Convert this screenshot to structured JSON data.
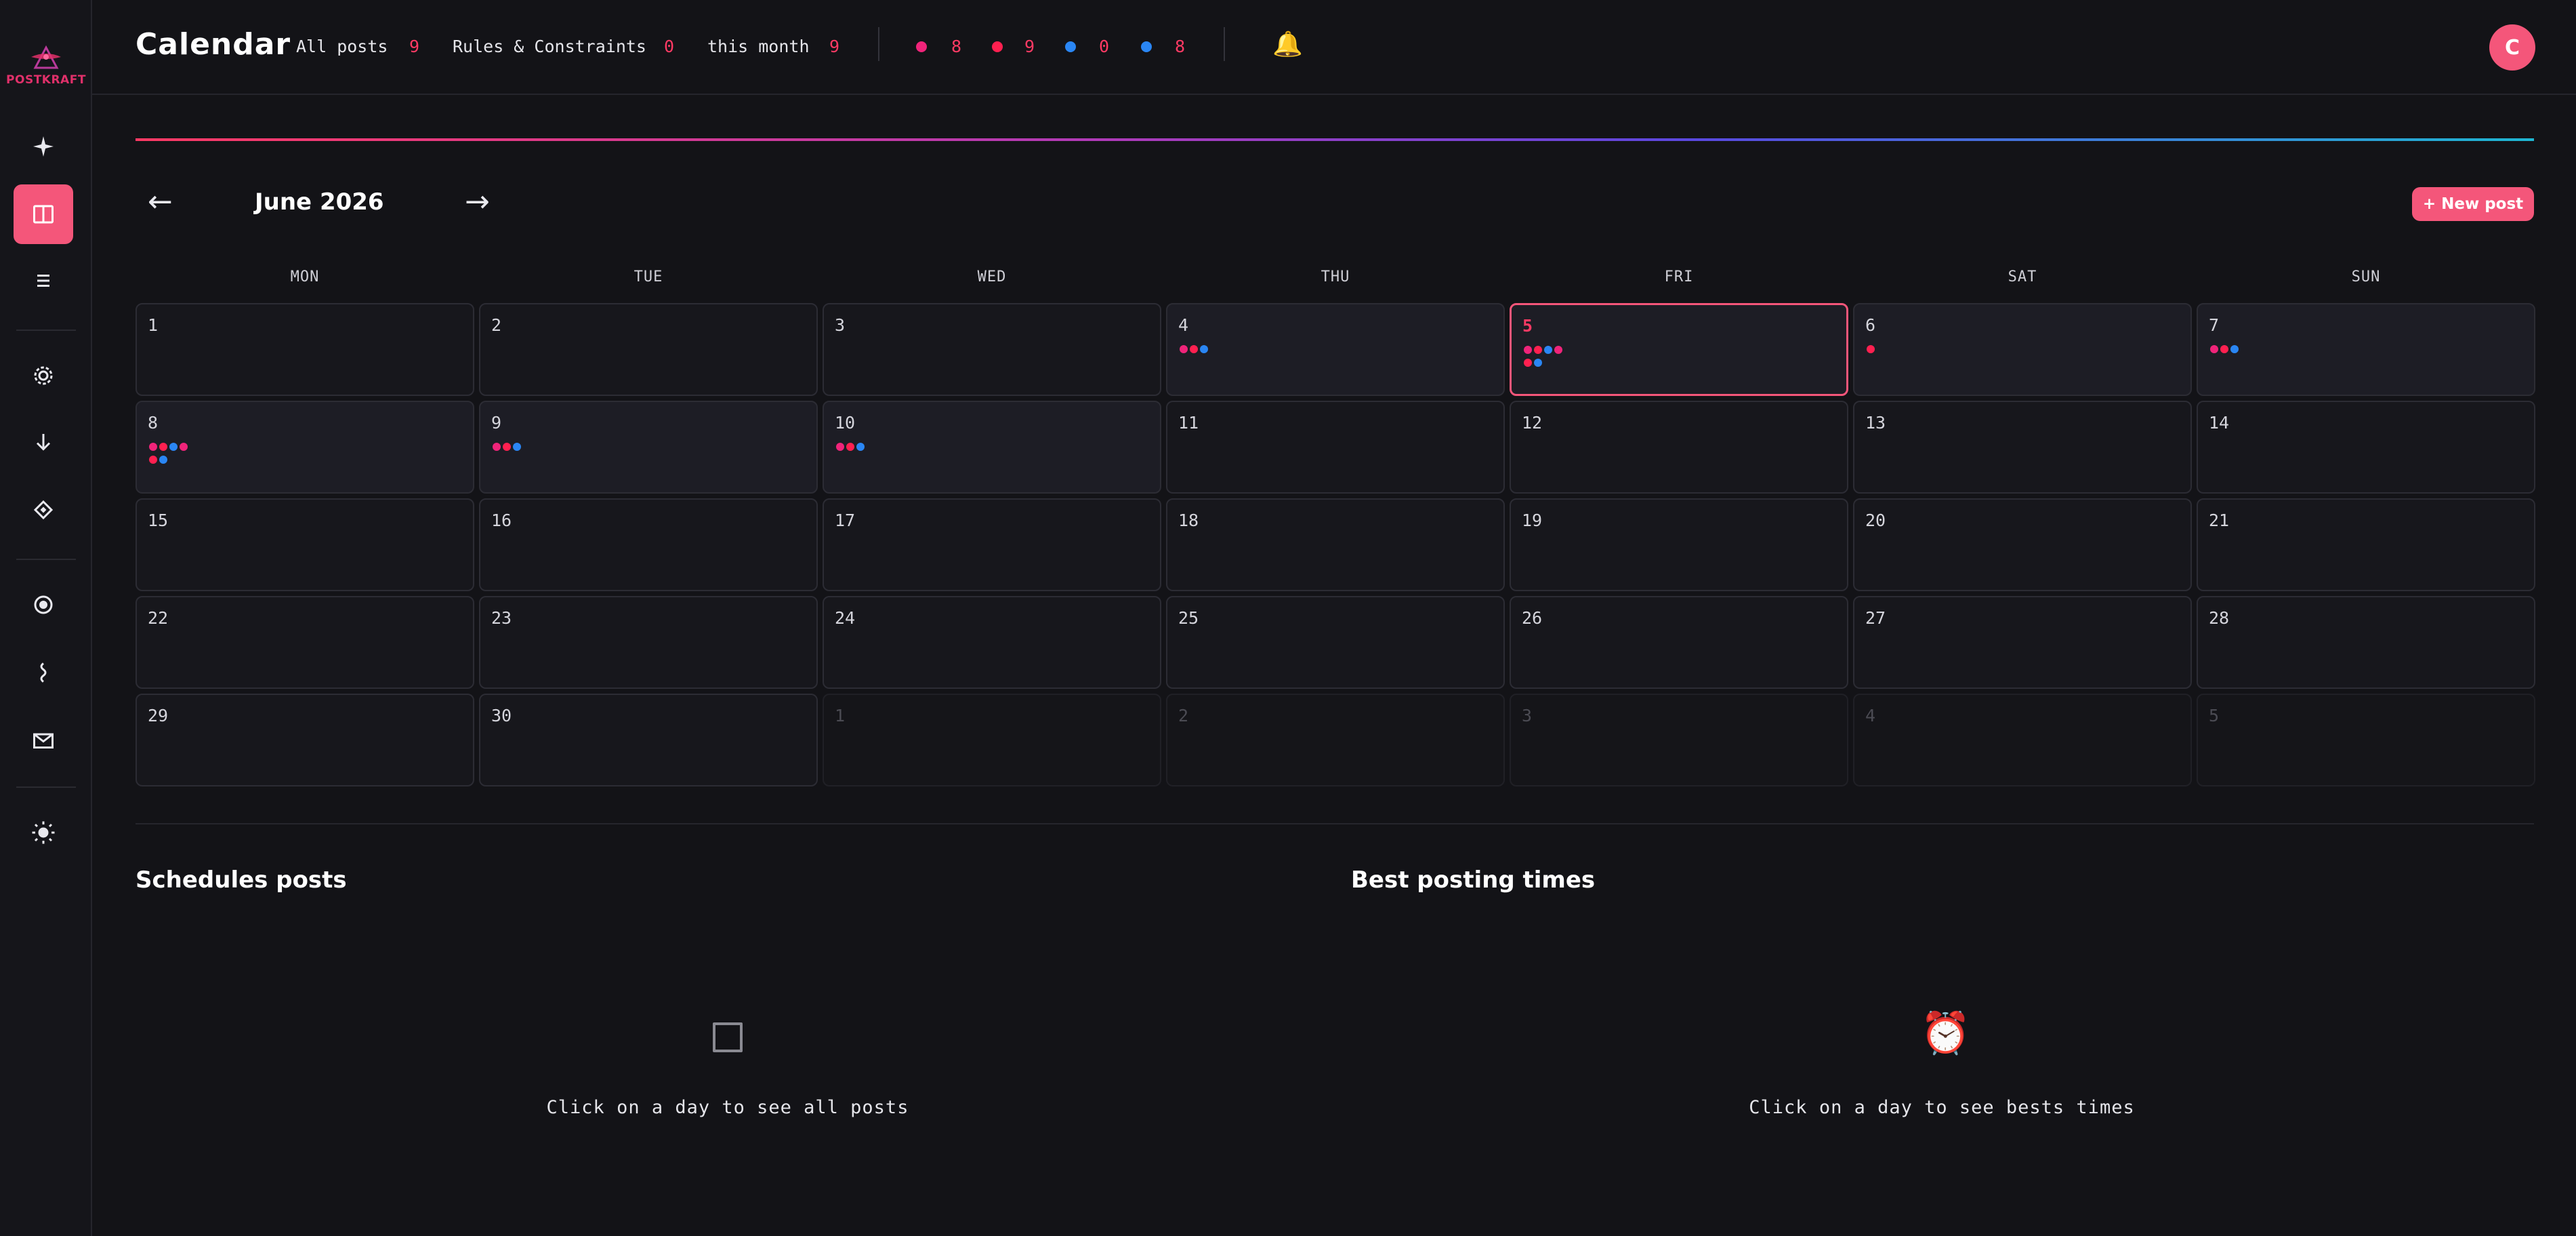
{
  "app": {
    "logo_text": "POSTKRAFT"
  },
  "header": {
    "title": "Calendar",
    "stats": [
      {
        "label": "All posts",
        "value": "9"
      },
      {
        "label": "Rules & Constraints",
        "value": "0"
      },
      {
        "label": "this month",
        "value": "9"
      }
    ],
    "channel_counts": [
      {
        "color": "#f0247a",
        "value": "8"
      },
      {
        "color": "#ff2050",
        "value": "9"
      },
      {
        "color": "#2a86f4",
        "value": "0"
      },
      {
        "color": "#2a86f4",
        "value": "8"
      }
    ],
    "notification_icon": "bell-icon",
    "avatar_initial": "C"
  },
  "sidebar": {
    "items": [
      {
        "name": "sparkle",
        "active": false
      },
      {
        "name": "calendar",
        "active": true
      },
      {
        "name": "list",
        "active": false
      },
      {
        "name": "settings",
        "active": false
      },
      {
        "name": "download",
        "active": false
      },
      {
        "name": "diamond",
        "active": false
      },
      {
        "name": "record",
        "active": false
      },
      {
        "name": "wave",
        "active": false
      },
      {
        "name": "mail",
        "active": false
      },
      {
        "name": "theme",
        "active": false
      }
    ]
  },
  "calendar": {
    "month_label": "June 2026",
    "prev_label": "←",
    "next_label": "→",
    "new_post_label": "+ New post",
    "weekdays": [
      "MON",
      "TUE",
      "WED",
      "THU",
      "FRI",
      "SAT",
      "SUN"
    ],
    "today": "5",
    "days": [
      {
        "n": "1",
        "dots": []
      },
      {
        "n": "2",
        "dots": []
      },
      {
        "n": "3",
        "dots": []
      },
      {
        "n": "4",
        "dots": [
          "pink",
          "red",
          "blue"
        ]
      },
      {
        "n": "5",
        "dots": [
          "pink",
          "red",
          "blue",
          "pink",
          "red",
          "blue"
        ]
      },
      {
        "n": "6",
        "dots": [
          "red"
        ]
      },
      {
        "n": "7",
        "dots": [
          "pink",
          "red",
          "blue"
        ]
      },
      {
        "n": "8",
        "dots": [
          "pink",
          "red",
          "blue",
          "pink",
          "red",
          "blue"
        ]
      },
      {
        "n": "9",
        "dots": [
          "pink",
          "red",
          "blue"
        ]
      },
      {
        "n": "10",
        "dots": [
          "pink",
          "red",
          "blue"
        ]
      },
      {
        "n": "11",
        "dots": []
      },
      {
        "n": "12",
        "dots": []
      },
      {
        "n": "13",
        "dots": []
      },
      {
        "n": "14",
        "dots": []
      },
      {
        "n": "15",
        "dots": []
      },
      {
        "n": "16",
        "dots": []
      },
      {
        "n": "17",
        "dots": []
      },
      {
        "n": "18",
        "dots": []
      },
      {
        "n": "19",
        "dots": []
      },
      {
        "n": "20",
        "dots": []
      },
      {
        "n": "21",
        "dots": []
      },
      {
        "n": "22",
        "dots": []
      },
      {
        "n": "23",
        "dots": []
      },
      {
        "n": "24",
        "dots": []
      },
      {
        "n": "25",
        "dots": []
      },
      {
        "n": "26",
        "dots": []
      },
      {
        "n": "27",
        "dots": []
      },
      {
        "n": "28",
        "dots": []
      },
      {
        "n": "29",
        "dots": []
      },
      {
        "n": "30",
        "dots": []
      },
      {
        "n": "1",
        "dots": [],
        "other": true
      },
      {
        "n": "2",
        "dots": [],
        "other": true
      },
      {
        "n": "3",
        "dots": [],
        "other": true
      },
      {
        "n": "4",
        "dots": [],
        "other": true
      },
      {
        "n": "5",
        "dots": [],
        "other": true
      }
    ]
  },
  "panels": {
    "scheduled": {
      "title": "Schedules posts",
      "empty_text": "Click on a day to see all posts",
      "icon": "square-icon"
    },
    "best_times": {
      "title": "Best posting times",
      "empty_text": "Click on a day to see bests times",
      "icon": "alarm-clock-icon"
    }
  },
  "colors": {
    "accent": "#f4567a",
    "pink": "#f0247a",
    "red": "#ff2050",
    "blue": "#2a86f4"
  }
}
